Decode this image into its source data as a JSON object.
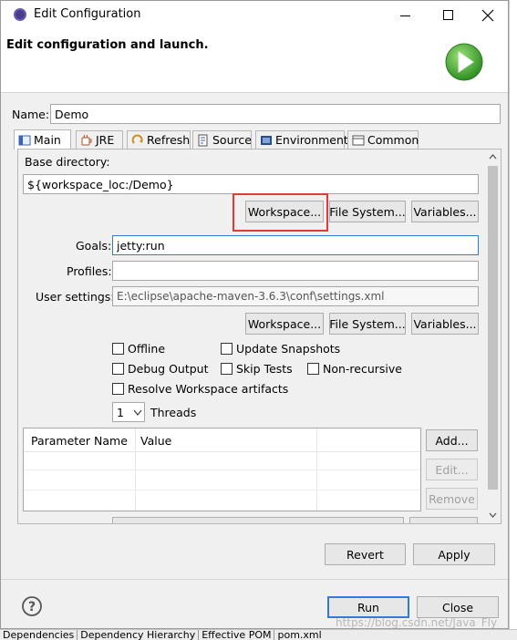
{
  "window": {
    "title": "Edit Configuration"
  },
  "banner": {
    "heading": "Edit configuration and launch."
  },
  "name": {
    "label": "Name:",
    "value": "Demo"
  },
  "tabs": [
    {
      "label": "Main",
      "icon": "main-tab-icon"
    },
    {
      "label": "JRE",
      "icon": "jre-icon"
    },
    {
      "label": "Refresh",
      "icon": "refresh-icon"
    },
    {
      "label": "Source",
      "icon": "source-icon"
    },
    {
      "label": "Environment",
      "icon": "environment-icon"
    },
    {
      "label": "Common",
      "icon": "common-icon"
    }
  ],
  "main": {
    "base_directory_label": "Base directory:",
    "base_directory_value": "${workspace_loc:/Demo}",
    "workspace_btn": "Workspace...",
    "filesystem_btn": "File System...",
    "variables_btn": "Variables...",
    "goals_label": "Goals:",
    "goals_value": "jetty:run",
    "profiles_label": "Profiles:",
    "profiles_value": "",
    "user_settings_label": "User settings:",
    "user_settings_value": "E:\\eclipse\\apache-maven-3.6.3\\conf\\settings.xml",
    "checkboxes": {
      "offline": "Offline",
      "update_snapshots": "Update Snapshots",
      "debug_output": "Debug Output",
      "skip_tests": "Skip Tests",
      "non_recursive": "Non-recursive",
      "resolve_workspace": "Resolve Workspace artifacts"
    },
    "threads_value": "1",
    "threads_label": "Threads",
    "table": {
      "col_name": "Parameter Name",
      "col_value": "Value"
    },
    "add_btn": "Add...",
    "edit_btn": "Edit...",
    "remove_btn": "Remove"
  },
  "footer": {
    "revert_btn": "Revert",
    "apply_btn": "Apply",
    "run_btn": "Run",
    "close_btn": "Close"
  },
  "background": {
    "bottom_tabs": [
      "Dependencies",
      "Dependency Hierarchy",
      "Effective POM",
      "pom.xml"
    ],
    "watermark": "https://blog.csdn.net/Java_Fly"
  },
  "colors": {
    "highlight": "#e53935",
    "focus": "#2f7bd6",
    "run_green": "#3aa02d"
  }
}
